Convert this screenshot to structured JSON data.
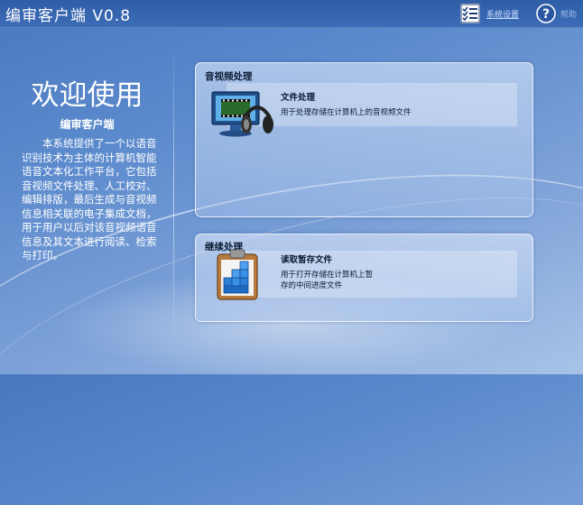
{
  "window": {
    "title": "编审客户端 V0.8"
  },
  "header": {
    "settings_label": "系统设置",
    "help_label": "帮助"
  },
  "welcome": {
    "title": "欢迎使用",
    "subtitle": "编审客户端",
    "description": "本系统提供了一个以语音识别技术为主体的计算机智能语音文本化工作平台，它包括音视频文件处理、人工校对、编辑排版，最后生成与音视频信息相关联的电子集成文档，用于用户以后对该音视频语音信息及其文本进行阅读、检索与打印。"
  },
  "cards": [
    {
      "title": "音视频处理",
      "item": {
        "title": "文件处理",
        "description": "用于处理存储在计算机上的音视频文件",
        "icon": "monitor-headphones-icon"
      }
    },
    {
      "title": "继续处理",
      "item": {
        "title": "读取暂存文件",
        "description": "用于打开存储在计算机上暂存的中间进度文件",
        "icon": "clipboard-cubes-icon"
      }
    }
  ],
  "icons": {
    "settings": "settings-list-icon",
    "help": "help-circle-icon"
  }
}
